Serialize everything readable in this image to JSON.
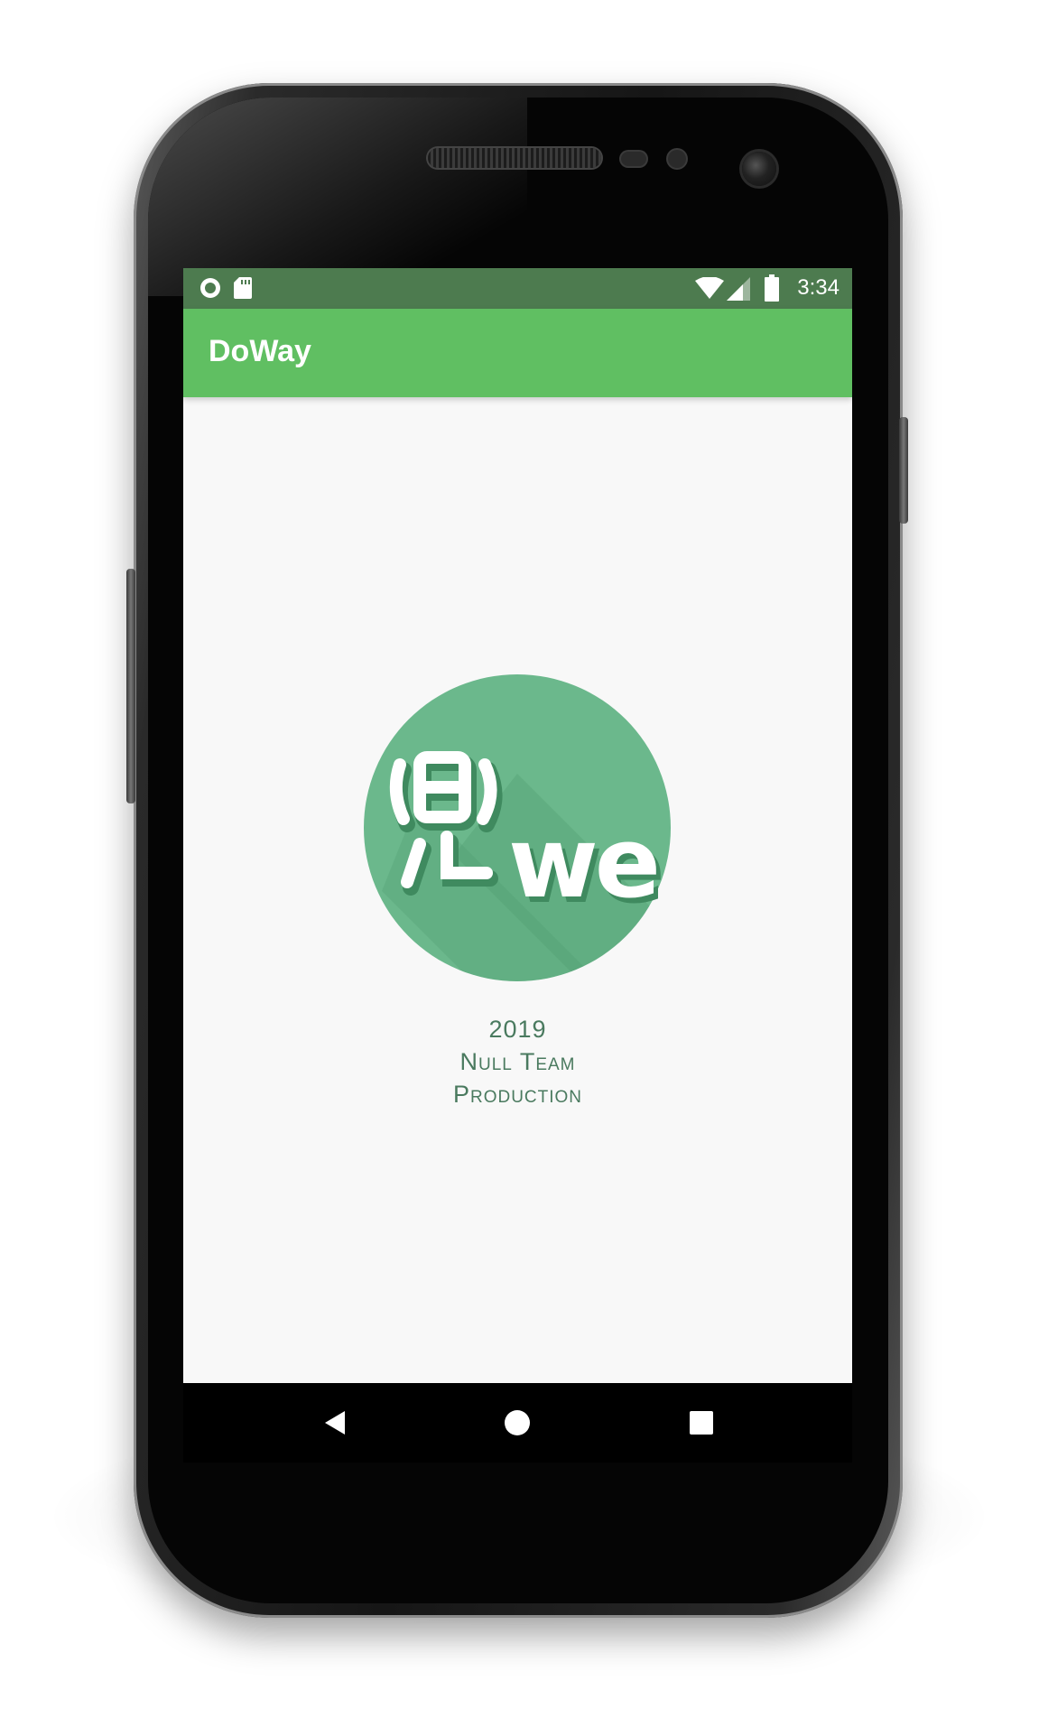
{
  "app": {
    "title": "DoWay"
  },
  "status_bar": {
    "time": "3:34",
    "icons": [
      "record-icon",
      "sd-card-icon",
      "wifi-icon",
      "cell-signal-icon",
      "battery-icon"
    ]
  },
  "splash": {
    "logo_alt": "DoWay logo",
    "logo_text": "we",
    "credit_lines": [
      "2019",
      "Null Team",
      "Production"
    ]
  },
  "nav_bar": {
    "buttons": [
      "back-icon",
      "home-icon",
      "recents-icon"
    ]
  },
  "colors": {
    "status_bar": "#4d7b4f",
    "app_bar": "#60bf62",
    "logo_circle": "#6bb88c",
    "credit_text": "#4a7a5f",
    "screen_bg": "#f8f8f8"
  }
}
